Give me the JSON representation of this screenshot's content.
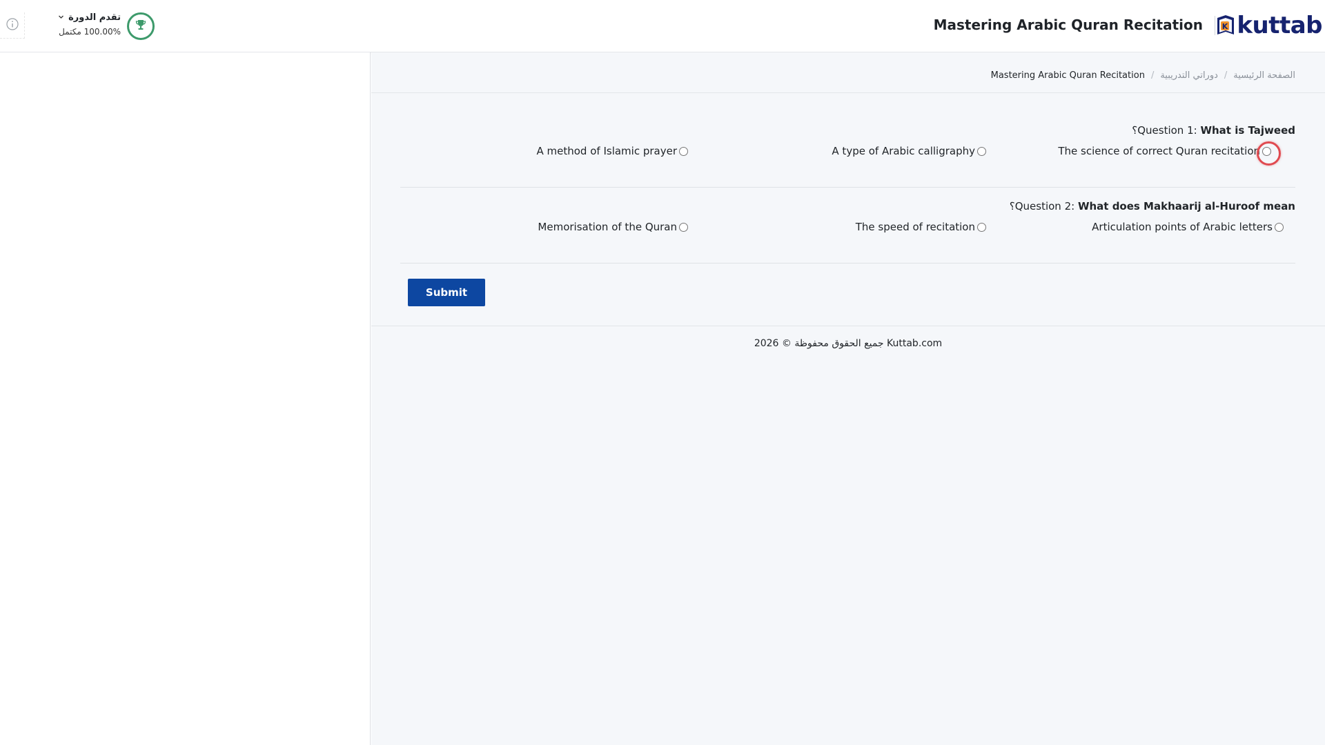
{
  "header": {
    "logo_text": "kuttab",
    "course_title": "Mastering Arabic Quran Recitation",
    "progress_title": "تقدم الدورة",
    "progress_value": "100.00% مكتمل",
    "progress_fraction": 1.0
  },
  "breadcrumb": {
    "home": "الصفحة الرئيسية",
    "my_courses": "دوراتي التدريبية",
    "current": "Mastering Arabic Quran Recitation",
    "separator": "/"
  },
  "quiz": {
    "questions": [
      {
        "prefix": "Question 1: ",
        "text": "What is Tajweed",
        "qmark": "؟",
        "options": [
          "The science of correct Quran recitation",
          "A type of Arabic calligraphy",
          "A method of Islamic prayer"
        ]
      },
      {
        "prefix": "Question 2: ",
        "text": "What does Makhaarij al-Huroof mean",
        "qmark": "؟",
        "options": [
          "Articulation points of Arabic letters",
          "The speed of recitation",
          "Memorisation of the Quran"
        ]
      }
    ],
    "submit_label": "Submit"
  },
  "footer": {
    "text": "جميع الحقوق محفوظة © 2026 Kuttab.com"
  },
  "colors": {
    "brand": "#16236f",
    "submit": "#0d47a1",
    "trophy": "#3d9a6b",
    "focus_ring": "#e04a50"
  }
}
